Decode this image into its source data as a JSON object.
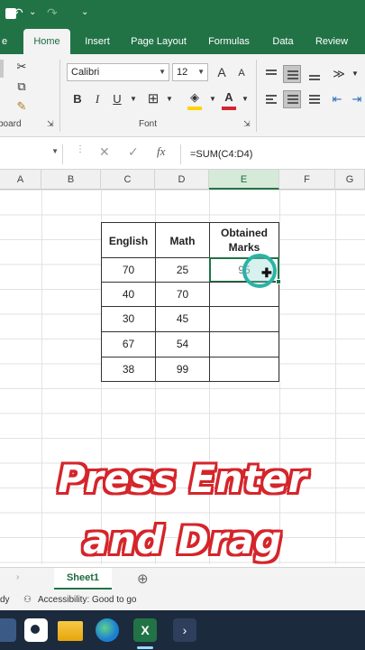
{
  "quick_access": {
    "undo": "↶",
    "undo_drop": "⌄",
    "redo": "↷",
    "customize": "⌄"
  },
  "tabs": [
    {
      "label": "e"
    },
    {
      "label": "Home"
    },
    {
      "label": "Insert"
    },
    {
      "label": "Page Layout"
    },
    {
      "label": "Formulas"
    },
    {
      "label": "Data"
    },
    {
      "label": "Review"
    }
  ],
  "ribbon": {
    "font_name": "Calibri",
    "font_size": "12",
    "grow_font": "A",
    "shrink_font": "A",
    "bold": "B",
    "italic": "I",
    "underline": "U",
    "font_color_letter": "A",
    "clipboard_group": "board",
    "font_group": "Font",
    "accent_red": "#d4252b",
    "accent_yellow": "#ffd400"
  },
  "formula_bar": {
    "cancel": "✕",
    "enter": "✓",
    "fx": "fx",
    "formula": "=SUM(C4:D4)"
  },
  "columns": [
    {
      "label": "A"
    },
    {
      "label": "B"
    },
    {
      "label": "C"
    },
    {
      "label": "D"
    },
    {
      "label": "E"
    },
    {
      "label": "F"
    },
    {
      "label": "G"
    }
  ],
  "table": {
    "headers": [
      "English",
      "Math",
      "Obtained Marks"
    ],
    "rows": [
      [
        "70",
        "25",
        "95"
      ],
      [
        "40",
        "70",
        ""
      ],
      [
        "30",
        "45",
        ""
      ],
      [
        "67",
        "54",
        ""
      ],
      [
        "38",
        "99",
        ""
      ]
    ]
  },
  "caption": {
    "line1": "Press Enter",
    "line2": "and Drag"
  },
  "sheet": {
    "name": "Sheet1",
    "add": "⊕"
  },
  "status": {
    "ready": "dy",
    "accessibility": "Accessibility: Good to go"
  },
  "colors": {
    "excel_green": "#217346",
    "taskbar": "#1c2a3d",
    "cursor_teal": "#2bb3a5"
  }
}
